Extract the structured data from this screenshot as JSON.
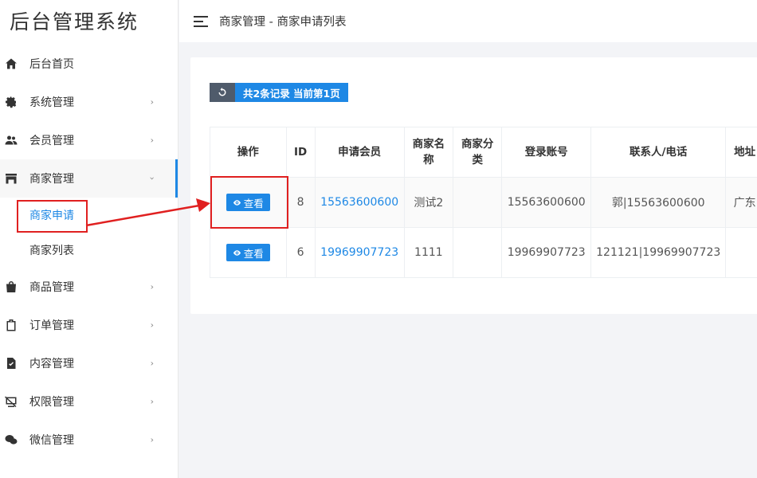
{
  "app": {
    "title": "后台管理系统"
  },
  "breadcrumb": "商家管理 - 商家申请列表",
  "sidebar": {
    "items": [
      {
        "label": "后台首页",
        "icon": "home-icon",
        "has_arrow": false
      },
      {
        "label": "系统管理",
        "icon": "gear-icon",
        "has_arrow": true
      },
      {
        "label": "会员管理",
        "icon": "users-icon",
        "has_arrow": true
      },
      {
        "label": "商家管理",
        "icon": "store-icon",
        "has_arrow": true,
        "expanded": true
      },
      {
        "label": "商品管理",
        "icon": "shopping-bag-icon",
        "has_arrow": true
      },
      {
        "label": "订单管理",
        "icon": "clipboard-icon",
        "has_arrow": true
      },
      {
        "label": "内容管理",
        "icon": "document-check-icon",
        "has_arrow": true
      },
      {
        "label": "权限管理",
        "icon": "desktop-off-icon",
        "has_arrow": true
      },
      {
        "label": "微信管理",
        "icon": "wechat-icon",
        "has_arrow": true
      }
    ],
    "submenu": [
      {
        "label": "商家申请",
        "current": true
      },
      {
        "label": "商家列表",
        "current": false
      }
    ],
    "arrow_right": "›",
    "arrow_down": "›"
  },
  "toolbar": {
    "summary": "共2条记录 当前第1页"
  },
  "table": {
    "headers": [
      "操作",
      "ID",
      "申请会员",
      "商家名称",
      "商家分类",
      "登录账号",
      "联系人/电话",
      "地址"
    ],
    "rows": [
      {
        "action": "查看",
        "id": "8",
        "member": "15563600600",
        "name": "测试2",
        "category": "",
        "account": "15563600600",
        "contact": "郭|15563600600",
        "addr": "广东"
      },
      {
        "action": "查看",
        "id": "6",
        "member": "19969907723",
        "name": "1111",
        "category": "",
        "account": "19969907723",
        "contact": "121121|19969907723",
        "addr": ""
      }
    ]
  },
  "colors": {
    "accent": "#1e88e5",
    "annotation": "#e02020",
    "refresh_bg": "#4f5b6b"
  }
}
